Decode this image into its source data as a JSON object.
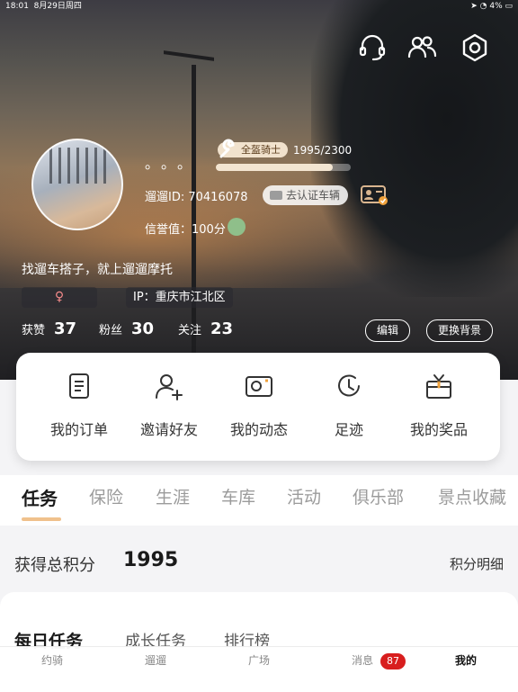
{
  "status_bar": {
    "time": "18:01",
    "date": "8月29日周四",
    "battery": "4%"
  },
  "top_icons": [
    "headset-icon",
    "friends-icon",
    "settings-icon"
  ],
  "profile": {
    "nickname": "。。。",
    "level_badge": "全盔骑士",
    "level_score": "1995/2300",
    "level_progress": 0.8674,
    "user_id": "遛遛ID: 70416078",
    "verify_button": "去认证车辆",
    "credit": "信誉值：100分",
    "slogan": "找遛车搭子，就上遛遛摩托",
    "gender_symbol": "♀",
    "ip": "IP：重庆市江北区",
    "stats": [
      {
        "label": "获赞",
        "value": "37"
      },
      {
        "label": "粉丝",
        "value": "30"
      },
      {
        "label": "关注",
        "value": "23"
      }
    ],
    "edit_button": "编辑",
    "change_bg_button": "更换背景"
  },
  "menu": [
    {
      "label": "我的订单",
      "icon": "order-icon"
    },
    {
      "label": "邀请好友",
      "icon": "invite-icon"
    },
    {
      "label": "我的动态",
      "icon": "moments-icon"
    },
    {
      "label": "足迹",
      "icon": "footprint-icon"
    },
    {
      "label": "我的奖品",
      "icon": "prize-icon"
    }
  ],
  "tabs": [
    "任务",
    "保险",
    "生涯",
    "车库",
    "活动",
    "俱乐部",
    "景点收藏"
  ],
  "active_tab": "任务",
  "points": {
    "label": "获得总积分",
    "value": "1995",
    "detail_link": "积分明细"
  },
  "task_tabs": [
    "每日任务",
    "成长任务",
    "排行榜"
  ],
  "bottom_nav": [
    {
      "label": "约骑"
    },
    {
      "label": "遛遛"
    },
    {
      "label": "广场"
    },
    {
      "label": "消息",
      "badge": "87"
    },
    {
      "label": "我的"
    }
  ],
  "colors": {
    "accent": "#f0c18c",
    "badge_red": "#d81e1e",
    "level_badge_bg": "#f1e2cd"
  }
}
